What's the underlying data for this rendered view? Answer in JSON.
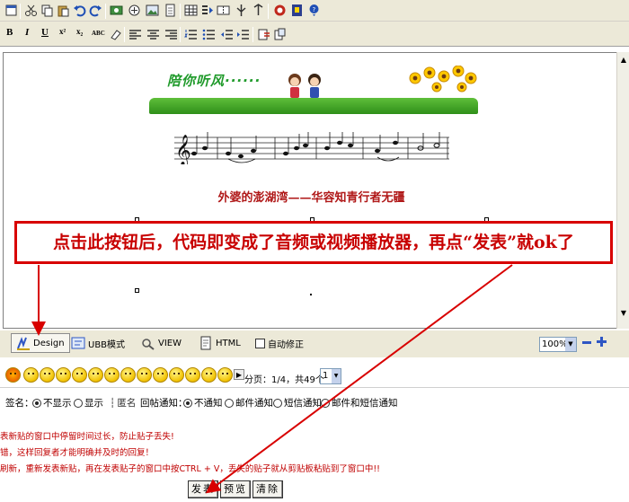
{
  "editor": {
    "banner_text": "陪你听风······",
    "song_title": "外婆的澎湖湾——华容知青行者无疆"
  },
  "annotation": {
    "instruction": "点击此按钮后，代码即变成了音频或视频播放器，再点“发表”就ok了",
    "color": "#d80000"
  },
  "modes": {
    "design": "Design",
    "ubb": "UBB模式",
    "view": "VIEW",
    "html": "HTML",
    "auto_fix": "自动修正",
    "zoom": "100%"
  },
  "emoticons": {
    "page_info": "分页：1/4，共49个",
    "page_value": "1"
  },
  "options": {
    "signature_label": "签名：",
    "sig_hide": "不显示",
    "sig_show": "显示",
    "anonymous": "匿名",
    "reply_notify_label": "回帖通知：",
    "no_notify": "不通知",
    "email_notify": "邮件通知",
    "sms_notify": "短信通知",
    "email_sms_notify": "邮件和短信通知"
  },
  "tips": [
    "表新贴的窗口中停留时间过长，防止贴子丢失!",
    "错，这样回复者才能明确并及时的回复！",
    "刷新，重新发表新贴，再在发表贴子的窗口中按CTRL + V，丢失的贴子就从剪贴板粘贴到了窗口中!!"
  ],
  "buttons": {
    "post": "发表",
    "preview": "预览",
    "clear": "清除"
  }
}
